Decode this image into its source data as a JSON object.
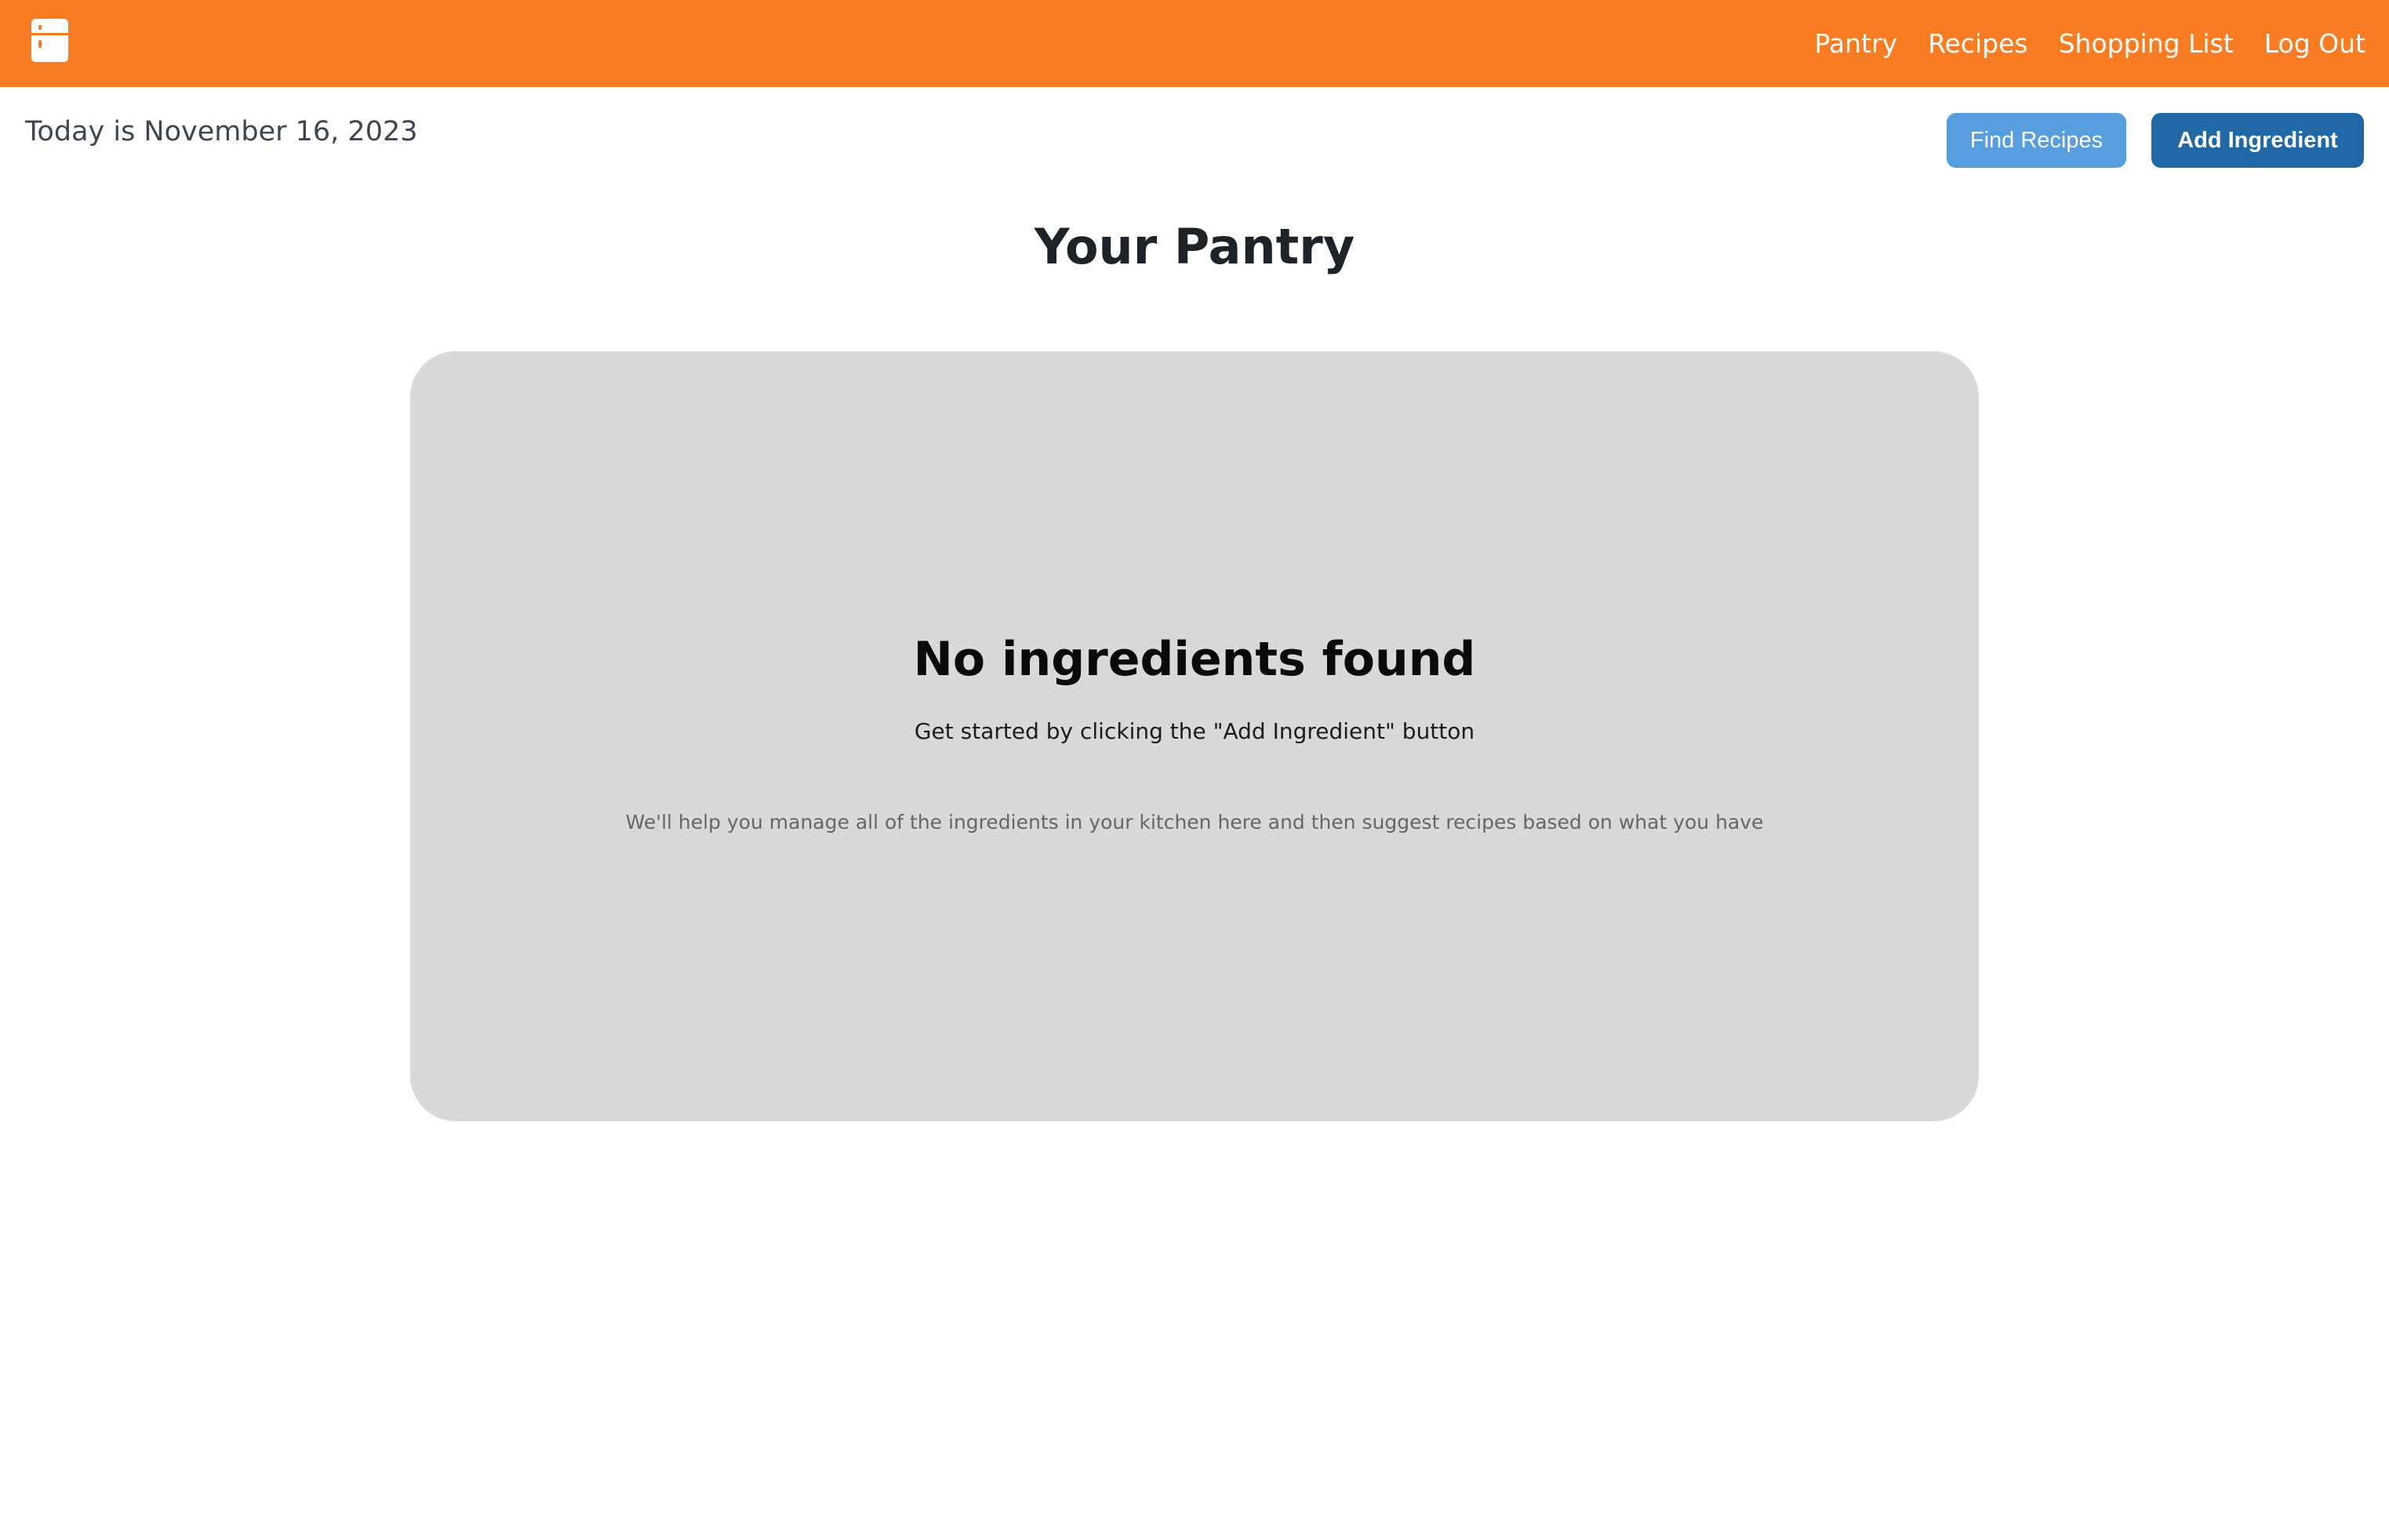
{
  "navbar": {
    "logo_icon": "fridge-icon",
    "background_color": "#fa7c22",
    "links": [
      {
        "label": "Pantry"
      },
      {
        "label": "Recipes"
      },
      {
        "label": "Shopping List"
      },
      {
        "label": "Log Out"
      }
    ]
  },
  "toolbar": {
    "date_text": "Today is November 16, 2023",
    "find_recipes_label": "Find Recipes",
    "add_ingredient_label": "Add Ingredient"
  },
  "main": {
    "title": "Your Pantry",
    "empty_state": {
      "heading": "No ingredients found",
      "subheading": "Get started by clicking the \"Add Ingredient\" button",
      "note": "We'll help you manage all of the ingredients in your kitchen here and then suggest recipes based on what you have"
    }
  },
  "colors": {
    "accent": "#fa7c22",
    "primary_button": "#2067a5",
    "secondary_button": "#569ede",
    "card_background": "#d9d9d9"
  }
}
